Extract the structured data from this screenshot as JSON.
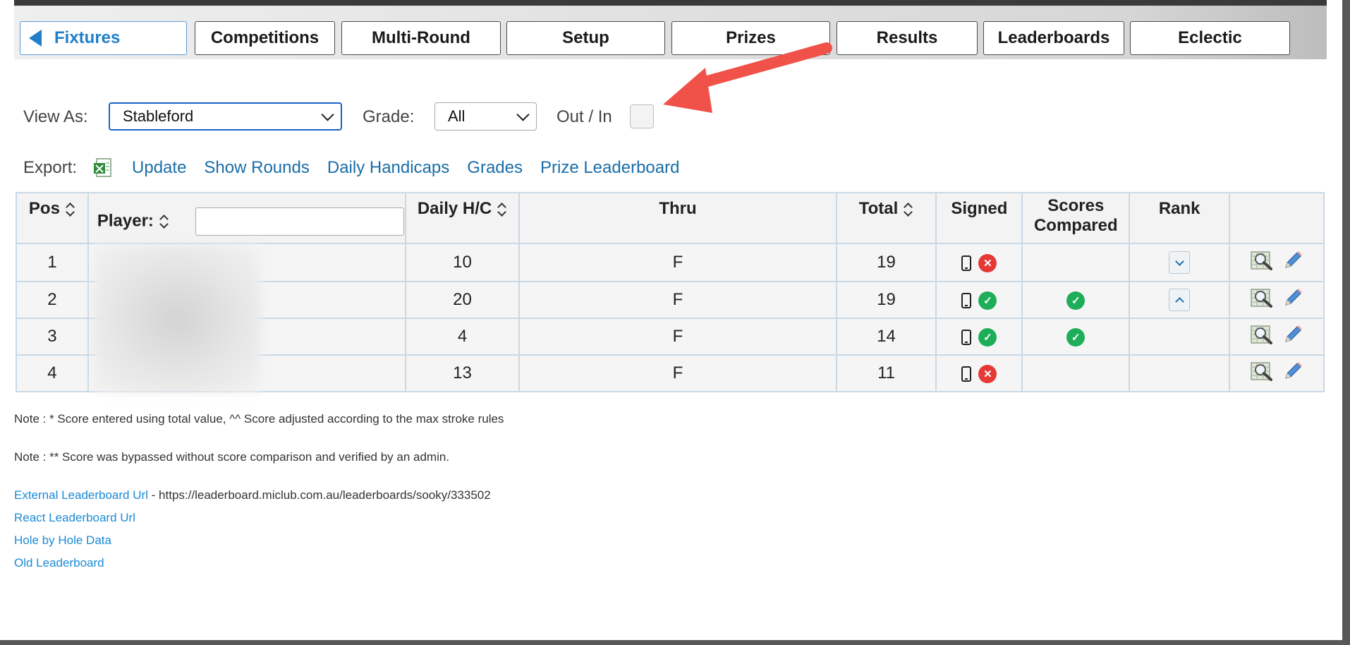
{
  "tabs": [
    "Fixtures",
    "Competitions",
    "Multi-Round",
    "Setup",
    "Prizes",
    "Results",
    "Leaderboards",
    "Eclectic"
  ],
  "active_tab": "Fixtures",
  "filters": {
    "view_as_label": "View As:",
    "view_as_value": "Stableford",
    "grade_label": "Grade:",
    "grade_value": "All",
    "outin_label": "Out / In"
  },
  "export": {
    "label": "Export:",
    "links": [
      "Update",
      "Show Rounds",
      "Daily Handicaps",
      "Grades",
      "Prize Leaderboard"
    ]
  },
  "table": {
    "headers": {
      "pos": "Pos",
      "player": "Player:",
      "daily_hc": "Daily H/C",
      "thru": "Thru",
      "total": "Total",
      "signed": "Signed",
      "scores_compared_1": "Scores",
      "scores_compared_2": "Compared",
      "rank": "Rank"
    },
    "rows": [
      {
        "pos": "1",
        "daily_hc": "10",
        "thru": "F",
        "total": "19",
        "signed": "unsigned",
        "compared": "",
        "rank_button": "down"
      },
      {
        "pos": "2",
        "daily_hc": "20",
        "thru": "F",
        "total": "19",
        "signed": "signed",
        "compared": "check",
        "rank_button": "up"
      },
      {
        "pos": "3",
        "daily_hc": "4",
        "thru": "F",
        "total": "14",
        "signed": "signed",
        "compared": "check",
        "rank_button": ""
      },
      {
        "pos": "4",
        "daily_hc": "13",
        "thru": "F",
        "total": "11",
        "signed": "unsigned",
        "compared": "",
        "rank_button": ""
      }
    ]
  },
  "notes": {
    "note1": "Note : * Score entered using total value, ^^ Score adjusted according to the max stroke rules",
    "note2": "Note : ** Score was bypassed without score comparison and verified by an admin."
  },
  "footer": {
    "external_label": "External Leaderboard Url",
    "external_url": " - https://leaderboard.miclub.com.au/leaderboards/sooky/333502",
    "react_label": "React Leaderboard Url",
    "hole_label": "Hole by Hole Data",
    "old_label": "Old Leaderboard"
  },
  "colors": {
    "link": "#1a6ea8",
    "accent_arrow": "#f0524a",
    "signed_ok": "#1eae5a",
    "signed_no": "#e53935"
  }
}
